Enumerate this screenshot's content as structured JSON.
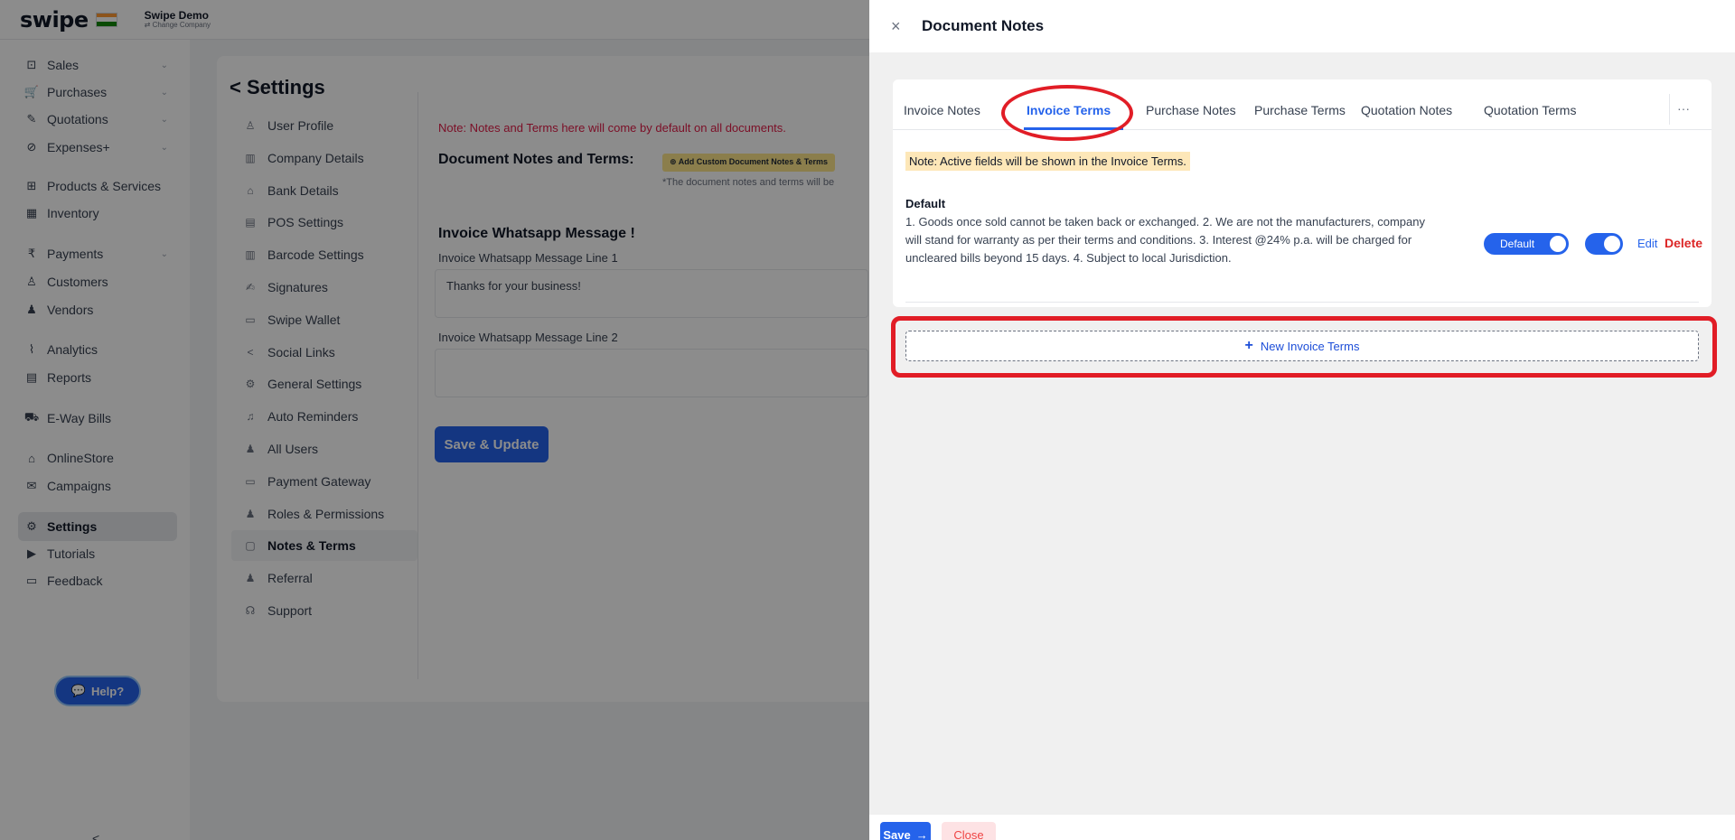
{
  "app": {
    "brand": "swipe",
    "company_name": "Swipe Demo",
    "company_sub": "⇄ Change Company",
    "flag_colors": [
      "#ff9933",
      "#ffffff",
      "#138808"
    ]
  },
  "sidebar": {
    "items": [
      {
        "label": "Sales",
        "icon": "sales-icon",
        "glyph": "⊡",
        "chevron": true
      },
      {
        "label": "Purchases",
        "icon": "cart-icon",
        "glyph": "🛒",
        "chevron": true
      },
      {
        "label": "Quotations",
        "icon": "pen-icon",
        "glyph": "✎",
        "chevron": true
      },
      {
        "label": "Expenses+",
        "icon": "expenses-icon",
        "glyph": "⊘",
        "chevron": true
      },
      {
        "label": "Products & Services",
        "icon": "products-icon",
        "glyph": "⊞",
        "chevron": false
      },
      {
        "label": "Inventory",
        "icon": "inventory-icon",
        "glyph": "▦",
        "chevron": false
      },
      {
        "label": "Payments",
        "icon": "rupee-icon",
        "glyph": "₹",
        "chevron": true
      },
      {
        "label": "Customers",
        "icon": "user-icon",
        "glyph": "♙",
        "chevron": false
      },
      {
        "label": "Vendors",
        "icon": "users-icon",
        "glyph": "♟",
        "chevron": false
      },
      {
        "label": "Analytics",
        "icon": "chart-icon",
        "glyph": "⌇",
        "chevron": false
      },
      {
        "label": "Reports",
        "icon": "report-icon",
        "glyph": "▤",
        "chevron": false
      },
      {
        "label": "E-Way Bills",
        "icon": "truck-icon",
        "glyph": "⛟",
        "chevron": false
      },
      {
        "label": "OnlineStore",
        "icon": "store-icon",
        "glyph": "⌂",
        "chevron": false
      },
      {
        "label": "Campaigns",
        "icon": "megaphone-icon",
        "glyph": "✉",
        "chevron": false
      },
      {
        "label": "Settings",
        "icon": "gear-icon",
        "glyph": "⚙",
        "chevron": false
      },
      {
        "label": "Tutorials",
        "icon": "youtube-icon",
        "glyph": "▶",
        "chevron": false
      },
      {
        "label": "Feedback",
        "icon": "chat-icon",
        "glyph": "▭",
        "chevron": false
      }
    ],
    "active": "Settings",
    "help_label": "Help?",
    "collapse_glyph": "<"
  },
  "settings": {
    "title": "Settings",
    "back_glyph": "<",
    "menu": [
      {
        "label": "User Profile",
        "glyph": "♙"
      },
      {
        "label": "Company Details",
        "glyph": "▥"
      },
      {
        "label": "Bank Details",
        "glyph": "⌂"
      },
      {
        "label": "POS Settings",
        "glyph": "▤"
      },
      {
        "label": "Barcode Settings",
        "glyph": "▥"
      },
      {
        "label": "Signatures",
        "glyph": "✍"
      },
      {
        "label": "Swipe Wallet",
        "glyph": "▭"
      },
      {
        "label": "Social Links",
        "glyph": "<"
      },
      {
        "label": "General Settings",
        "glyph": "⚙"
      },
      {
        "label": "Auto Reminders",
        "glyph": "♫"
      },
      {
        "label": "All Users",
        "glyph": "♟"
      },
      {
        "label": "Payment Gateway",
        "glyph": "▭"
      },
      {
        "label": "Roles & Permissions",
        "glyph": "♟"
      },
      {
        "label": "Notes & Terms",
        "glyph": "▢"
      },
      {
        "label": "Referral",
        "glyph": "♟"
      },
      {
        "label": "Support",
        "glyph": "☊"
      }
    ],
    "active": "Notes & Terms",
    "note": "Note: Notes and Terms here will come by default on all documents.",
    "doc_label": "Document Notes and Terms:",
    "custom_button": "Add Custom Document Notes & Terms",
    "doc_hint": "*The document notes and terms will be",
    "wa_title": "Invoice Whatsapp Message !",
    "wa_label1": "Invoice Whatsapp Message Line 1",
    "wa_value1": "Thanks for your business!",
    "wa_label2": "Invoice Whatsapp Message Line 2",
    "wa_value2": "",
    "save_update": "Save & Update"
  },
  "drawer": {
    "title": "Document Notes",
    "close_glyph": "×",
    "tabs": [
      "Invoice Notes",
      "Invoice Terms",
      "Purchase Notes",
      "Purchase Terms",
      "Quotation Notes",
      "Quotation Terms"
    ],
    "active_tab": "Invoice Terms",
    "more_glyph": "···",
    "active_note": "Note: Active fields will be shown in the Invoice Terms.",
    "term": {
      "name": "Default",
      "text": "1. Goods once sold cannot be taken back or exchanged. 2. We are not the manufacturers, company will stand for warranty as per their terms and conditions. 3. Interest @24% p.a. will be charged for uncleared bills beyond 15 days. 4. Subject to local Jurisdiction.",
      "default_label": "Default",
      "enabled": true,
      "edit_label": "Edit",
      "delete_label": "Delete"
    },
    "new_terms_label": "New Invoice Terms",
    "save_label": "Save",
    "save_arrow": "→",
    "close_label": "Close"
  },
  "colors": {
    "primary": "#2563eb",
    "danger": "#dc2626",
    "annotation": "#e11d26",
    "highlight": "#fde7b8"
  }
}
